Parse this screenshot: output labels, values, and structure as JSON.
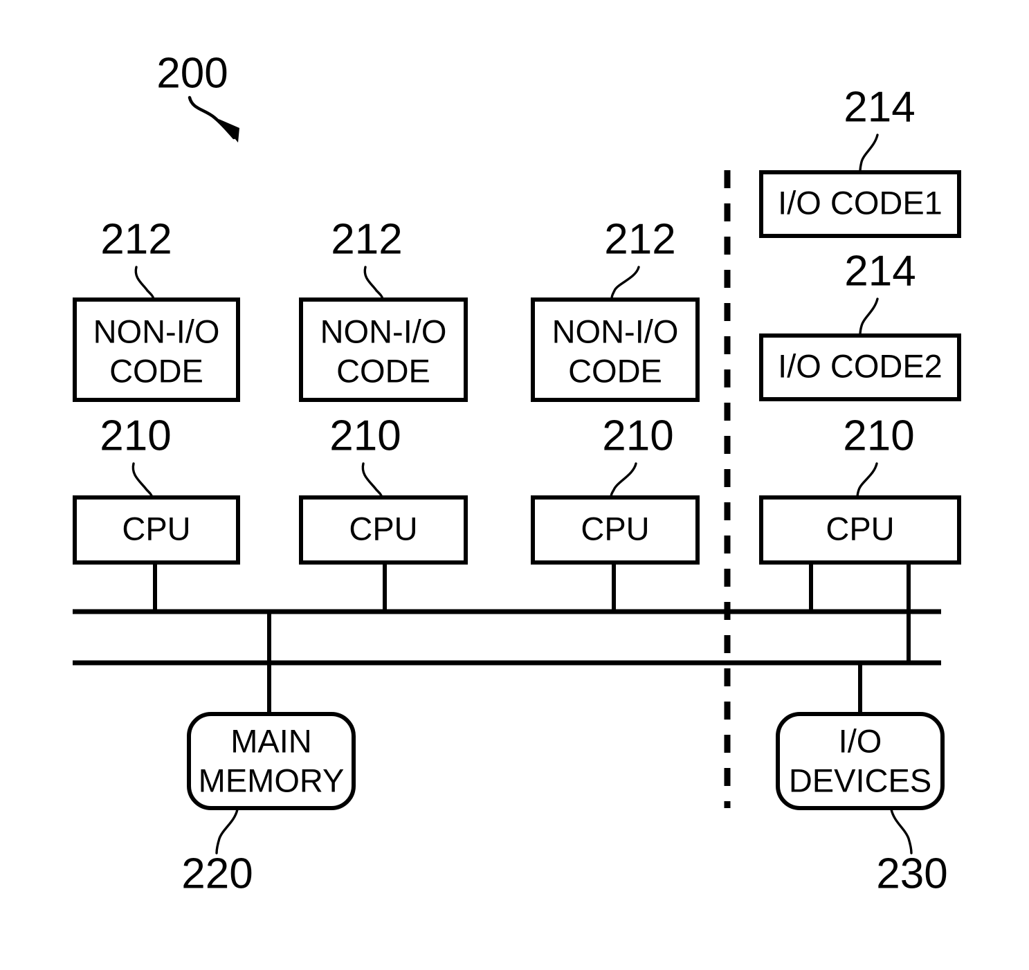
{
  "figure": {
    "figure_number": "200",
    "reference_numerals": {
      "cpu": "210",
      "non_io_code": "212",
      "io_code": "214",
      "main_memory": "220",
      "io_devices": "230"
    },
    "blocks": {
      "non_io_code": [
        {
          "label_line1": "NON-I/O",
          "label_line2": "CODE",
          "ref": "212"
        },
        {
          "label_line1": "NON-I/O",
          "label_line2": "CODE",
          "ref": "212"
        },
        {
          "label_line1": "NON-I/O",
          "label_line2": "CODE",
          "ref": "212"
        }
      ],
      "io_code": [
        {
          "label": "I/O CODE1",
          "ref": "214"
        },
        {
          "label": "I/O CODE2",
          "ref": "214"
        }
      ],
      "cpus": [
        {
          "label": "CPU",
          "ref": "210"
        },
        {
          "label": "CPU",
          "ref": "210"
        },
        {
          "label": "CPU",
          "ref": "210"
        },
        {
          "label": "CPU",
          "ref": "210"
        }
      ],
      "main_memory": {
        "label_line1": "MAIN",
        "label_line2": "MEMORY",
        "ref": "220"
      },
      "io_devices": {
        "label_line1": "I/O",
        "label_line2": "DEVICES",
        "ref": "230"
      }
    },
    "colors": {
      "stroke": "#000000",
      "fill": "#ffffff",
      "background": "#ffffff"
    }
  }
}
